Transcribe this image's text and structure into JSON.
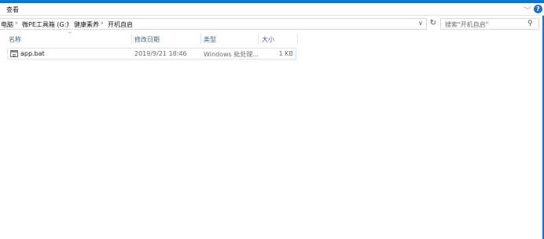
{
  "ribbon": {
    "tab_label": "查看"
  },
  "address": {
    "crumbs": [
      "电脑",
      "微PE工具箱 (G:)",
      "健康素养",
      "开机自启"
    ],
    "separator": "›"
  },
  "search": {
    "placeholder": "搜索\"开机自启\""
  },
  "columns": {
    "name": "名称",
    "modified": "修改日期",
    "type": "类型",
    "size": "大小"
  },
  "files": [
    {
      "name": "app.bat",
      "modified": "2019/9/21 18:46",
      "type": "Windows 批处理...",
      "size": "1 KB"
    }
  ],
  "colors": {
    "accent": "#0078d7",
    "selection_border": "#cce8ff",
    "header_text": "#4c607a"
  }
}
